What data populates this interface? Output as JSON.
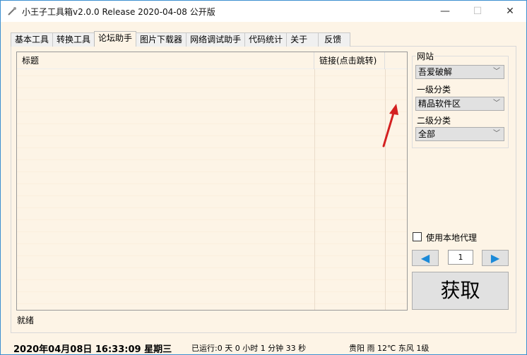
{
  "window": {
    "title": "小王子工具箱v2.0.0 Release 2020-04-08 公开版",
    "minimize": "—",
    "maximize": "☐",
    "close": "✕"
  },
  "tabs": [
    "基本工具",
    "转换工具",
    "论坛助手",
    "图片下载器",
    "网络调试助手",
    "代码统计",
    "关于",
    "反馈"
  ],
  "active_tab": 2,
  "table": {
    "columns": [
      "标题",
      "链接(点击跳转)"
    ],
    "rows": []
  },
  "filters": {
    "site_label": "网站",
    "site_value": "吾爱破解",
    "cat1_label": "一级分类",
    "cat1_value": "精品软件区",
    "cat2_label": "二级分类",
    "cat2_value": "全部"
  },
  "proxy": {
    "label": "使用本地代理",
    "checked": false
  },
  "pager": {
    "page": "1",
    "prev": "◀",
    "next": "▶"
  },
  "fetch_label": "获取",
  "status": "就绪",
  "footer": {
    "datetime": "2020年04月08日 16:33:09 星期三",
    "uptime": "已运行:0 天 0 小时 1 分钟 33 秒",
    "weather": "贵阳 雨 12℃ 东风 1级"
  },
  "colors": {
    "accent": "#1c8ad8",
    "background": "#fdf4e6",
    "annotation_arrow": "#d42020"
  }
}
